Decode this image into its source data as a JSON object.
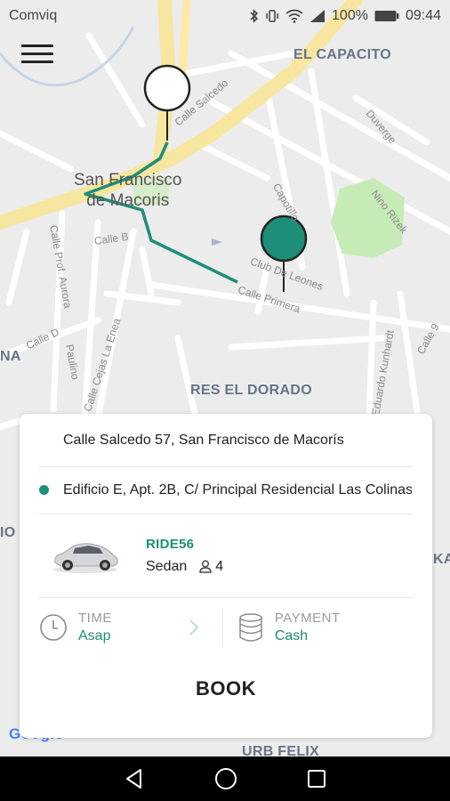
{
  "status_bar": {
    "carrier": "Comviq",
    "battery": "100%",
    "time": "09:44"
  },
  "map": {
    "labels": {
      "el_capacito": "EL CAPACITO",
      "city_line1": "San Francisco",
      "city_line2": "de Macoris",
      "calle_salcedo": "Calle Salcedo",
      "duverge": "Duverge",
      "nino_rizek": "Nino Rizek",
      "capotillo": "Capotillo",
      "calle_b": "Calle B",
      "calle_prof_aurora": "Calle Prof. Aurora",
      "club_de_leones": "Club De Leones",
      "calle_primera": "Calle Primera",
      "calle_d": "Calle D",
      "paulino": "Paulino",
      "res_el_dorado": "RES EL DORADO",
      "eduardo_kunhardt": "Eduardo Kunhardt",
      "calle_9": "Calle 9",
      "na": "NA",
      "io": "IO",
      "ka": "KA",
      "calle_cejas_la_enea": "Calle Cejas La Enea",
      "urb_felix": "URB FELIX",
      "google": "Google"
    }
  },
  "booking": {
    "pickup": "Calle Salcedo 57, San Francisco de Macorís",
    "dropoff": "Edificio E, Apt. 2B, C/ Principal Residencial Las Colinas",
    "car": {
      "code": "RIDE56",
      "type": "Sedan",
      "seats": "4"
    },
    "time": {
      "label": "TIME",
      "value": "Asap"
    },
    "payment": {
      "label": "PAYMENT",
      "value": "Cash"
    },
    "book_label": "BOOK"
  },
  "colors": {
    "accent": "#1d8e78",
    "map_bg": "#ececec",
    "road": "#ffffff",
    "main_road": "#f7e9a6",
    "park": "#bfe6b0"
  }
}
